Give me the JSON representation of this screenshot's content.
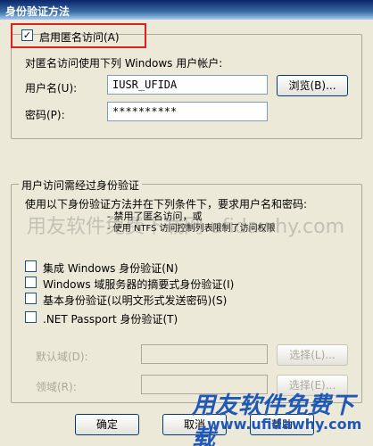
{
  "window": {
    "title": "身份验证方法"
  },
  "anonymous": {
    "checkbox_label": "启用匿名访问(A)",
    "checked": true,
    "description": "对匿名访问使用下列 Windows 用户帐户:",
    "username_label": "用户名(U):",
    "username_value": "IUSR_UFIDA",
    "password_label": "密码(P):",
    "password_value": "**********",
    "browse_label": "浏览(B)..."
  },
  "auth_group": {
    "legend": "用户访问需经过身份验证",
    "description": "使用以下身份验证方法并在下列条件下，要求用户名和密码:",
    "condition1": "- 禁用了匿名访问，或",
    "condition2": "- 使用 NTFS 访问控制列表限制了访问权限",
    "options": [
      {
        "label": "集成 Windows 身份验证(N)",
        "checked": false
      },
      {
        "label": "Windows 域服务器的摘要式身份验证(I)",
        "checked": false
      },
      {
        "label": "基本身份验证(以明文形式发送密码)(S)",
        "checked": false
      },
      {
        "label": ".NET Passport 身份验证(T)",
        "checked": false
      }
    ],
    "default_domain_label": "默认域(D):",
    "realm_label": "领域(R):",
    "select_label": "选择(L)...",
    "select2_label": "选择(E)..."
  },
  "footer": {
    "ok_label": "确定",
    "cancel_label": "取消",
    "help_label": "帮助"
  },
  "watermark": {
    "text": "用友软件免费下载网 ufidawhy.com",
    "logo_cn": "用友软件免费下载",
    "logo_url": "www.ufidawhy.com"
  },
  "colors": {
    "highlight_box": "#e0201a",
    "title_bar": "#0a246a"
  }
}
